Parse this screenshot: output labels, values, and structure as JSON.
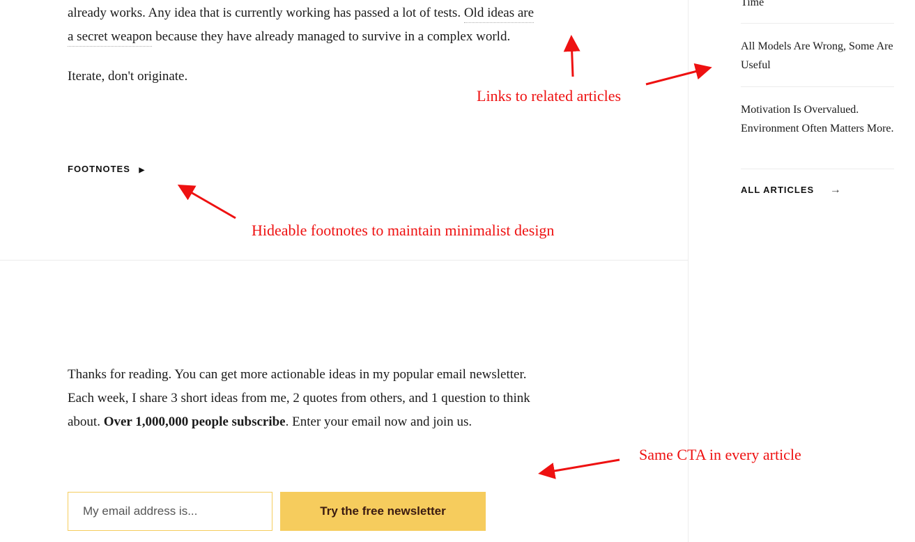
{
  "article": {
    "line1_text": "already works. Any idea that is currently working has passed a lot of tests. ",
    "link1": "Old ideas are",
    "link2": "a secret weapon",
    "line2_text": " because they have already managed to survive in a complex world.",
    "paragraph2": "Iterate, don't originate.",
    "footnotes_label": "FOOTNOTES"
  },
  "sidebar": {
    "partial_item": "Time",
    "items": [
      {
        "label": "All Models Are Wrong, Some Are Useful"
      },
      {
        "label": "Motivation Is Overvalued. Environment Often Matters More."
      }
    ],
    "all_articles": "ALL ARTICLES"
  },
  "cta": {
    "text_before": "Thanks for reading. You can get more actionable ideas in my popular email newsletter. Each week, I share 3 short ideas from me, 2 quotes from others, and 1 question to think about. ",
    "text_bold": "Over 1,000,000 people subscribe",
    "text_after": ". Enter your email now and join us.",
    "email_placeholder": "My email address is...",
    "button_label": "Try the free newsletter",
    "button_color": "#f6cc5d"
  },
  "annotations": {
    "related": "Links to related articles",
    "footnotes": "Hideable footnotes to maintain minimalist design",
    "cta": "Same CTA in every article",
    "color": "#ee1111"
  }
}
